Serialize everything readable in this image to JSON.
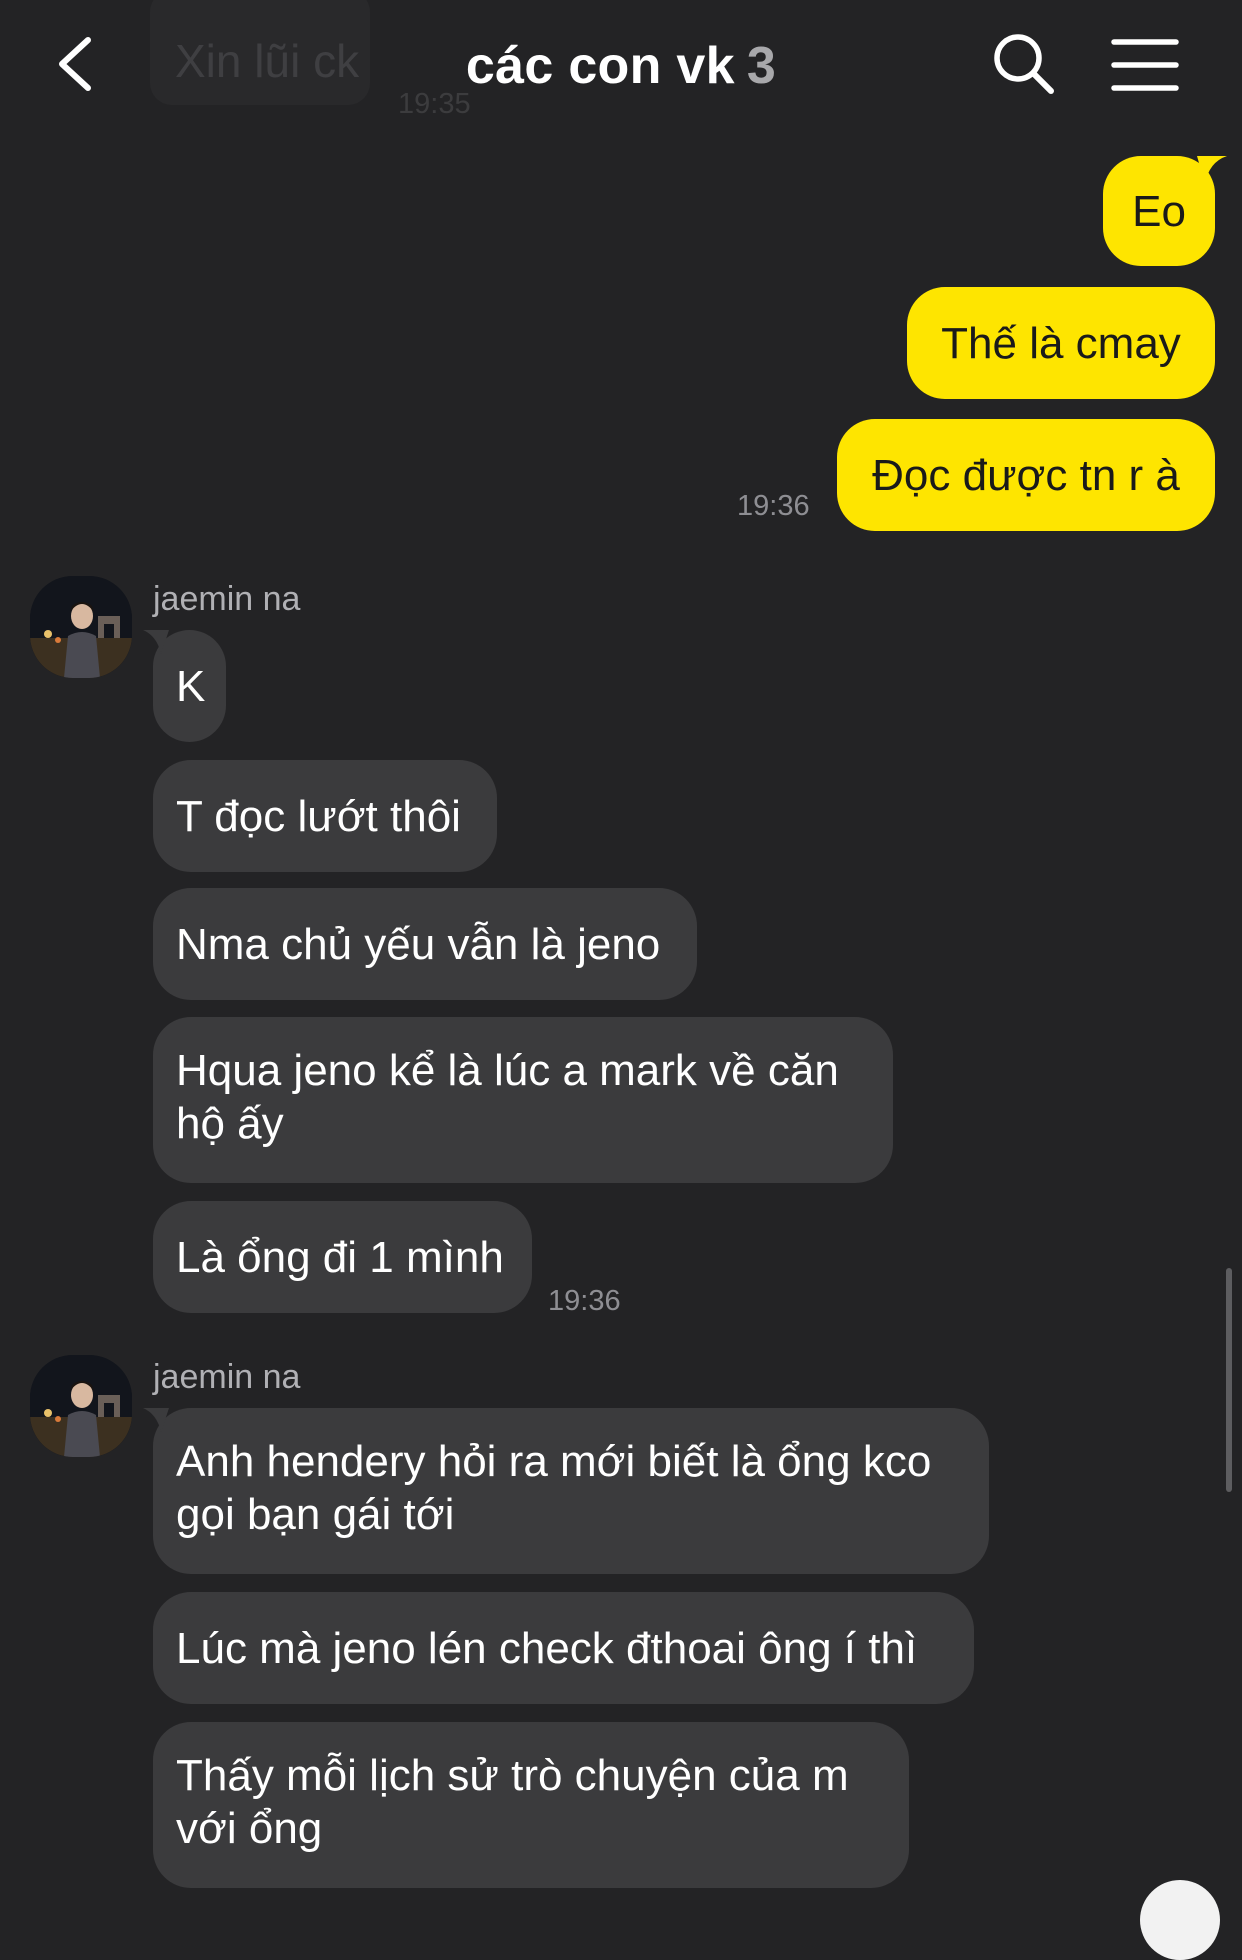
{
  "header": {
    "title": "các con vk",
    "member_count": "3",
    "back_icon": "chevron-left-icon",
    "search_icon": "search-icon",
    "menu_icon": "menu-icon"
  },
  "previous_message": {
    "text": "Xin lũi ck",
    "time": "19:35"
  },
  "sent_group": {
    "messages": [
      "Eo",
      "Thế là cmay",
      "Đọc được tn r à"
    ],
    "time": "19:36"
  },
  "received_group_1": {
    "sender": "jaemin na",
    "messages": [
      "K",
      "T đọc lướt thôi",
      "Nma chủ yếu vẫn là jeno",
      "Hqua jeno kể là lúc a mark về căn hộ ấy",
      "Là ổng đi 1 mình"
    ],
    "time": "19:36"
  },
  "received_group_2": {
    "sender": "jaemin na",
    "messages": [
      "Anh hendery hỏi ra mới biết là ổng kco gọi bạn gái tới",
      "Lúc mà jeno lén check đthoai ông í thì",
      "Thấy mỗi lịch sử trò chuyện của m với ổng"
    ]
  },
  "colors": {
    "background": "#232325",
    "sent_bubble": "#fee500",
    "received_bubble": "#3b3b3d",
    "timestamp": "#8e8e93"
  }
}
